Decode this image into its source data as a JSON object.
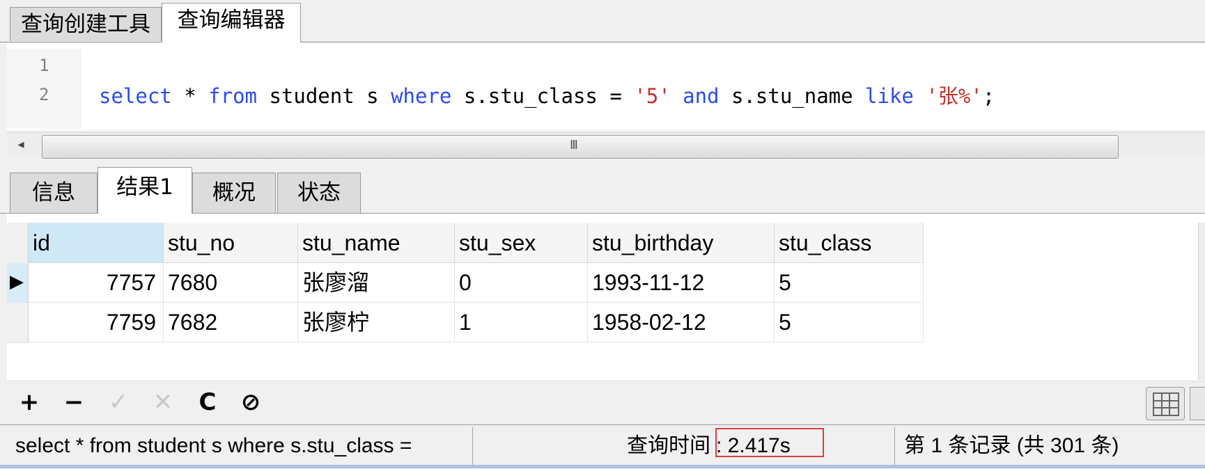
{
  "top_tabs": [
    "查询创建工具",
    "查询编辑器"
  ],
  "editor": {
    "line_numbers": [
      "1",
      "2"
    ],
    "sql_tokens": [
      {
        "t": "select",
        "c": "kw"
      },
      {
        "t": " * ",
        "c": "txt"
      },
      {
        "t": "from",
        "c": "kw"
      },
      {
        "t": " student s ",
        "c": "txt"
      },
      {
        "t": "where",
        "c": "kw"
      },
      {
        "t": " s.stu_class = ",
        "c": "txt"
      },
      {
        "t": "'5'",
        "c": "str"
      },
      {
        "t": " ",
        "c": "txt"
      },
      {
        "t": "and",
        "c": "kw"
      },
      {
        "t": " s.stu_name ",
        "c": "txt"
      },
      {
        "t": "like",
        "c": "kw"
      },
      {
        "t": " ",
        "c": "txt"
      },
      {
        "t": "'张%'",
        "c": "str"
      },
      {
        "t": ";",
        "c": "txt"
      }
    ],
    "hscroll_grip": "III",
    "hscroll_left_arrow": "◂"
  },
  "result_tabs": [
    "信息",
    "结果1",
    "概况",
    "状态"
  ],
  "grid": {
    "columns": [
      "id",
      "stu_no",
      "stu_name",
      "stu_sex",
      "stu_birthday",
      "stu_class"
    ],
    "rows": [
      [
        "7757",
        "7680",
        "张廖溜",
        "0",
        "1993-11-12",
        "5"
      ],
      [
        "7759",
        "7682",
        "张廖柠",
        "1",
        "1958-02-12",
        "5"
      ]
    ],
    "current_row_marker": "▶"
  },
  "toolbar": {
    "add": "+",
    "delete": "−",
    "apply": "✓",
    "discard": "✕",
    "refresh": "C",
    "stop": "⊘"
  },
  "status": {
    "sql_preview": "select * from student s where s.stu_class =",
    "query_time_label": "查询时间",
    "query_time_value": ": 2.417s",
    "record_info": "第 1 条记录 (共 301 条)"
  },
  "colors": {
    "keyword": "#2a4bf0",
    "string": "#c3312b",
    "highlight_box": "#e03b3b",
    "selected_header": "#cfe8f5"
  }
}
